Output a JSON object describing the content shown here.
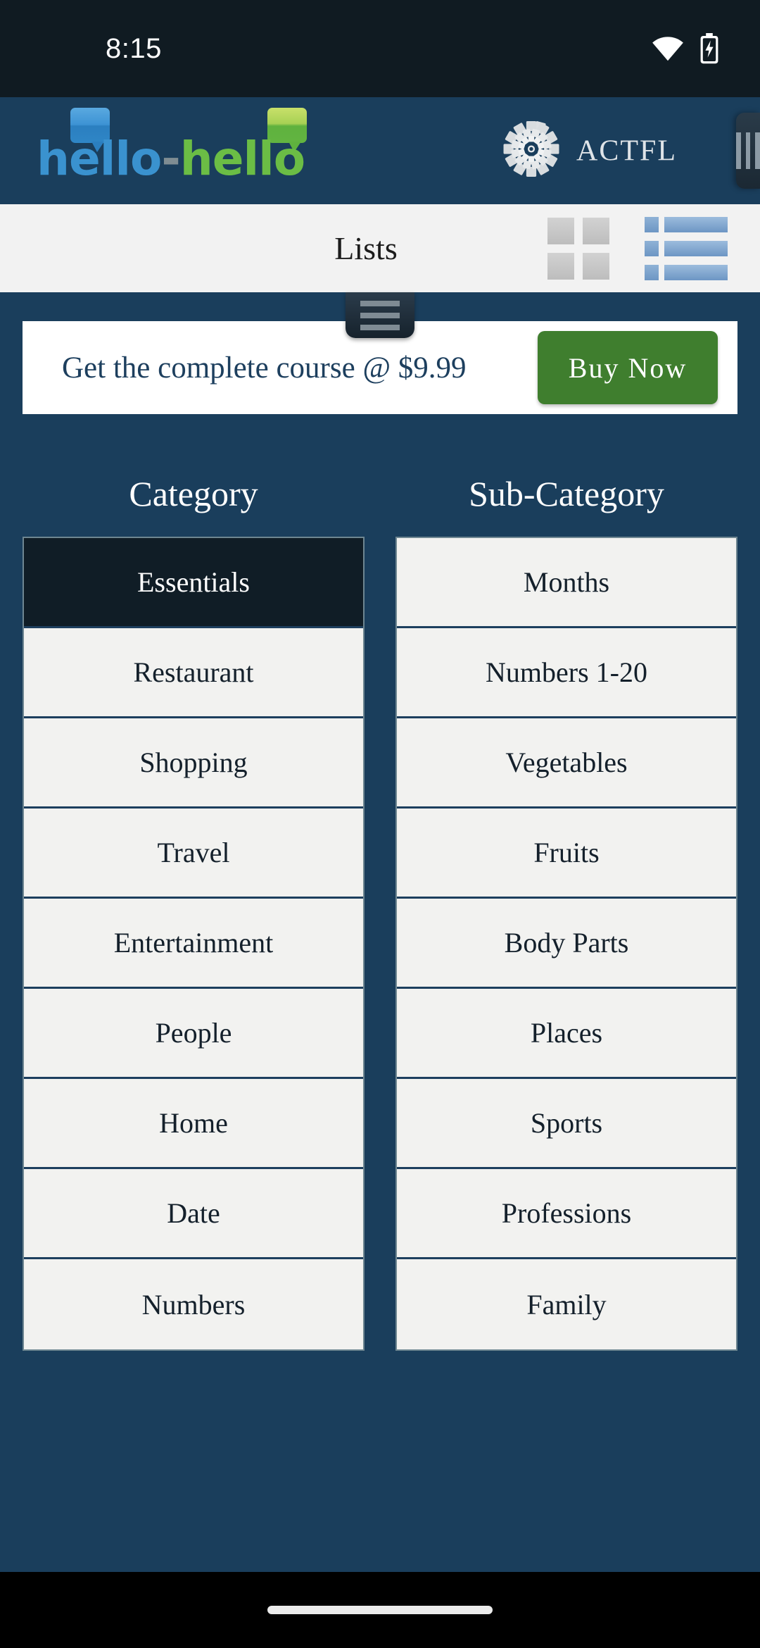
{
  "status_bar": {
    "time": "8:15",
    "wifi_icon": "wifi-icon",
    "battery_icon": "battery-charging-icon"
  },
  "header": {
    "logo": {
      "part1": "hello",
      "dash": "-",
      "part2": "hello",
      "bubble_blue_icon": "speech-bubble-icon",
      "bubble_green_icon": "speech-bubble-icon"
    },
    "partner": {
      "label": "ACTFL",
      "logo_icon": "actfl-rosette-icon"
    },
    "drawer_handle_icon": "drawer-handle-icon"
  },
  "toolbar": {
    "title": "Lists",
    "grid_view_icon": "grid-view-icon",
    "list_view_icon": "list-view-icon",
    "active_view": "list"
  },
  "promo": {
    "tab_handle_icon": "hamburger-tab-icon",
    "text": "Get the complete course @ $9.99",
    "buy_label": "Buy Now"
  },
  "columns": {
    "category": {
      "header": "Category",
      "selected": "Essentials",
      "items": [
        "Essentials",
        "Restaurant",
        "Shopping",
        "Travel",
        "Entertainment",
        "People",
        "Home",
        "Date",
        "Numbers"
      ]
    },
    "sub_category": {
      "header": "Sub-Category",
      "selected": null,
      "items": [
        "Months",
        "Numbers 1-20",
        "Vegetables",
        "Fruits",
        "Body Parts",
        "Places",
        "Sports",
        "Professions",
        "Family"
      ]
    }
  },
  "nav_bar": {
    "home_indicator_icon": "home-indicator-pill"
  },
  "colors": {
    "background": "#1a3e5c",
    "status_bar": "#101b22",
    "toolbar_bg": "#f2f2f2",
    "selected_item": "#101d26",
    "item_bg": "#f2f2f0",
    "buy_button": "#3f7e2e",
    "banner_text": "#1d3f5e",
    "logo_blue": "#3a92cf",
    "logo_green": "#6bbd45"
  }
}
